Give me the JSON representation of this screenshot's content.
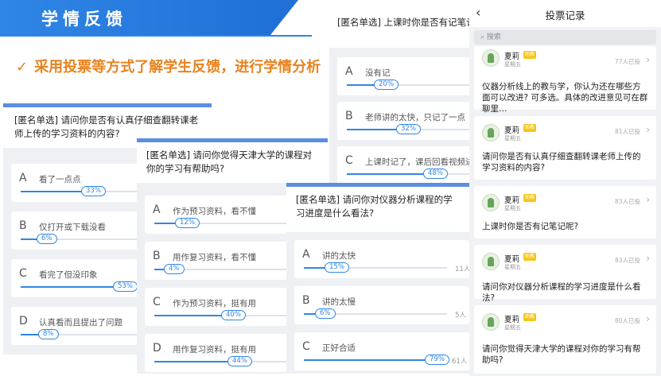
{
  "banner": {
    "title": "学情反馈"
  },
  "subtitle": {
    "check": "✓",
    "text": "采用投票等方式了解学生反馈，进行学情分析"
  },
  "poll1": {
    "question": "[匿名单选] 请问你是否有认真仔细查翻转课老师上传的学习资料的内容?",
    "options": [
      {
        "letter": "A",
        "text": "看了一点点",
        "percent": "33%",
        "fraction": 0.33
      },
      {
        "letter": "B",
        "text": "仅打开或下载没看",
        "percent": "6%",
        "fraction": 0.06
      },
      {
        "letter": "C",
        "text": "看完了但没印象",
        "percent": "53%",
        "fraction": 0.53
      },
      {
        "letter": "D",
        "text": "认真看而且提出了问题",
        "percent": "8%",
        "fraction": 0.08
      }
    ]
  },
  "poll2": {
    "question": "[匿名单选] 请问你觉得天津大学的课程对你的学习有帮助吗?",
    "options": [
      {
        "letter": "A",
        "text": "作为预习资料，看不懂",
        "percent": "12%",
        "fraction": 0.12
      },
      {
        "letter": "B",
        "text": "用作复习资料，看不懂",
        "percent": "4%",
        "fraction": 0.04
      },
      {
        "letter": "C",
        "text": "作为预习资料，挺有用",
        "percent": "40%",
        "fraction": 0.4
      },
      {
        "letter": "D",
        "text": "用作复习资料，挺有用",
        "percent": "44%",
        "fraction": 0.44
      }
    ]
  },
  "poll3": {
    "question": "[匿名单选] 上课时你是否有记笔记呢",
    "options": [
      {
        "letter": "A",
        "text": "没有记",
        "percent": "20%",
        "fraction": 0.2
      },
      {
        "letter": "B",
        "text": "老师讲的太快，只记了一点",
        "percent": "32%",
        "fraction": 0.32
      },
      {
        "letter": "C",
        "text": "上课时记了，课后回看视频进行",
        "percent": "48%",
        "fraction": 0.48
      }
    ]
  },
  "poll4": {
    "question": "[匿名单选] 请问你对仪器分析课程的学习进度是什么看法?",
    "options": [
      {
        "letter": "A",
        "text": "讲的太快",
        "percent": "15%",
        "fraction": 0.15,
        "count": "11人"
      },
      {
        "letter": "B",
        "text": "讲的太慢",
        "percent": "6%",
        "fraction": 0.06,
        "count": "5人"
      },
      {
        "letter": "C",
        "text": "正好合适",
        "percent": "79%",
        "fraction": 0.79,
        "count": "61人"
      }
    ]
  },
  "phone": {
    "back": "‹",
    "title": "投票记录",
    "search_placeholder": "搜索",
    "records": [
      {
        "name": "夏莉",
        "badge": "助教",
        "sub": "星期五",
        "count": "77人已投",
        "text": "仪器分析线上的教与学，你认为还在哪些方面可以改进? 可多选。具体的改进意见可在群聊里…"
      },
      {
        "name": "夏莉",
        "badge": "助教",
        "sub": "星期五",
        "count": "81人已投",
        "text": "请问你是否有认真仔细查翻转课老师上传的学习资料的内容?"
      },
      {
        "name": "夏莉",
        "badge": "助教",
        "sub": "星期五",
        "count": "83人已投",
        "text": "上课时你是否有记笔记呢?"
      },
      {
        "name": "夏莉",
        "badge": "助教",
        "sub": "星期五",
        "count": "83人已投",
        "text": "请问你对仪器分析课程的学习进度是什么看法?"
      },
      {
        "name": "夏莉",
        "badge": "助教",
        "sub": "星期五",
        "count": "80人已投",
        "text": "请问你觉得天津大学的课程对你的学习有帮助吗?"
      }
    ]
  }
}
